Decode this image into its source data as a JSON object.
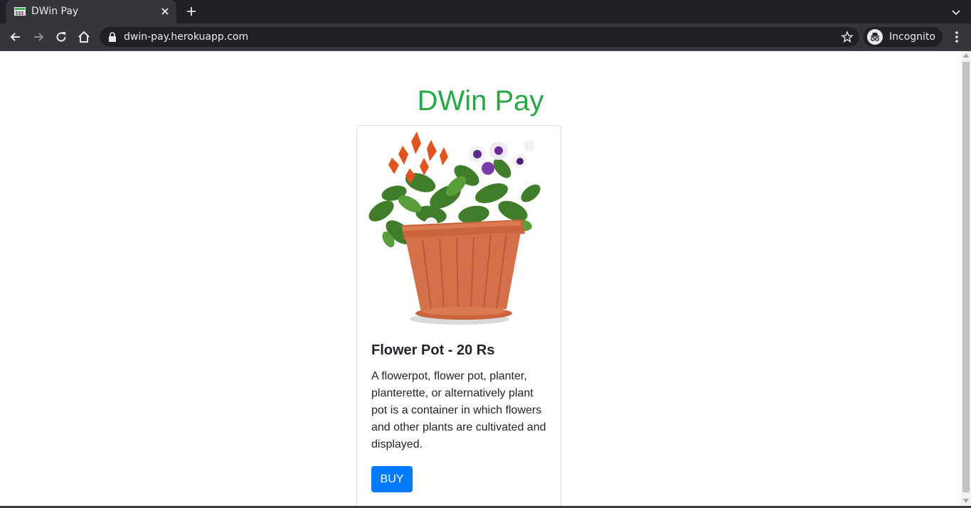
{
  "browser": {
    "tab_title": "DWin Pay",
    "url": "dwin-pay.herokuapp.com",
    "profile_label": "Incognito"
  },
  "page": {
    "title": "DWin Pay",
    "title_color": "#28a745",
    "product": {
      "image_alt": "Flower Pot",
      "title": "Flower Pot - 20 Rs",
      "description": "A flowerpot, flower pot, planter, planterette, or alternatively plant pot is a container in which flowers and other plants are cultivated and displayed.",
      "buy_label": "BUY"
    },
    "button_color": "#007bff"
  }
}
